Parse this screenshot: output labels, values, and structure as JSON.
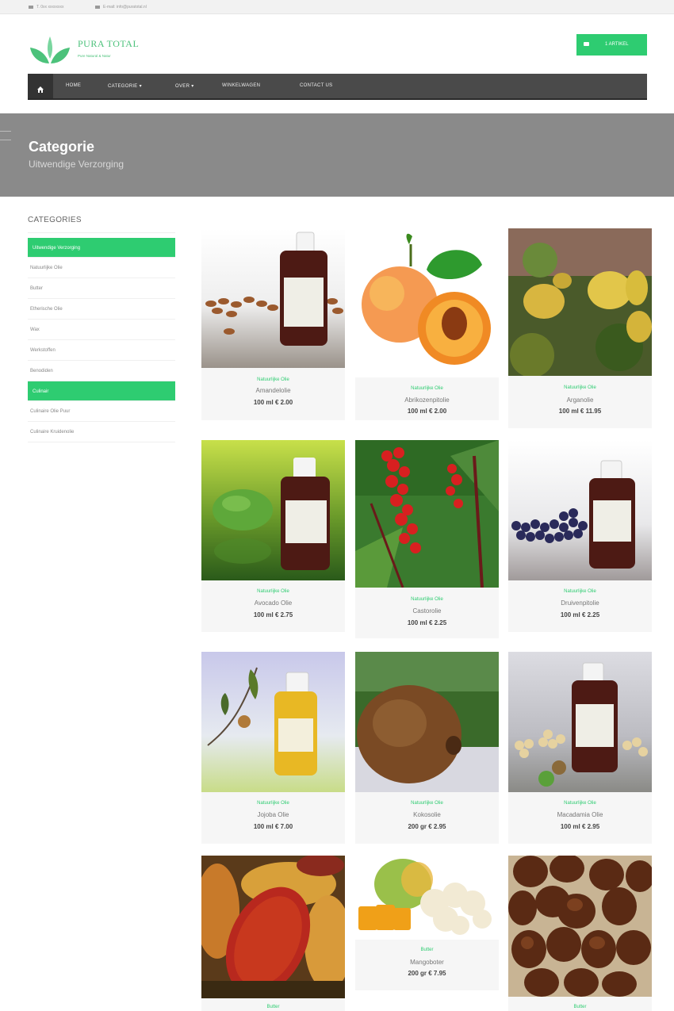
{
  "topbar": {
    "phone": "T. 0xx xxxxxxxx",
    "email": "E-mail: info@puratotal.nl"
  },
  "header": {
    "brand": "PURA TOTAL",
    "tagline": "Pure Natural & Natur"
  },
  "cart": {
    "label": "1 ARTIKEL"
  },
  "nav": {
    "items": [
      "HOME",
      "CATEGORIE",
      "OVER",
      "WINKELWAGEN",
      "CONTACT US"
    ]
  },
  "page": {
    "title": "Categorie",
    "subtitle": "Uitwendige Verzorging"
  },
  "sidebar": {
    "heading": "CATEGORIES",
    "items": [
      {
        "label": "Uitwendige Verzorging",
        "active": true
      },
      {
        "label": "Natuurlijke Olie",
        "active": false
      },
      {
        "label": "Butter",
        "active": false
      },
      {
        "label": "Etherische Olie",
        "active": false
      },
      {
        "label": "Wax",
        "active": false
      },
      {
        "label": "Werkstoffen",
        "active": false
      },
      {
        "label": "Benodiden",
        "active": false
      },
      {
        "label": "Culinair",
        "active": true
      },
      {
        "label": "Culinaire Olie Puur",
        "active": false
      },
      {
        "label": "Culinaire Kruidenolie",
        "active": false
      }
    ]
  },
  "products": [
    {
      "category": "Natuurlijke Olie",
      "name": "Amandelolie",
      "price": "100 ml € 2.00",
      "image": "almond-oil-bottle"
    },
    {
      "category": "Natuurlijke Olie",
      "name": "Abrikozenpitolie",
      "price": "100 ml € 2.00",
      "image": "apricot"
    },
    {
      "category": "Natuurlijke Olie",
      "name": "Arganolie",
      "price": "100 ml € 11.95",
      "image": "argan-fruit"
    },
    {
      "category": "Natuurlijke Olie",
      "name": "Avocado Olie",
      "price": "100 ml € 2.75",
      "image": "avocado-oil-bottle"
    },
    {
      "category": "Natuurlijke Olie",
      "name": "Castorolie",
      "price": "100 ml € 2.25",
      "image": "castor-plant"
    },
    {
      "category": "Natuurlijke Olie",
      "name": "Druivenpitolie",
      "price": "100 ml € 2.25",
      "image": "grapeseed-oil-bottle"
    },
    {
      "category": "Natuurlijke Olie",
      "name": "Jojoba Olie",
      "price": "100 ml € 7.00",
      "image": "jojoba-oil-bottle"
    },
    {
      "category": "Natuurlijke Olie",
      "name": "Kokosolie",
      "price": "200 gr € 2.95",
      "image": "coconut"
    },
    {
      "category": "Natuurlijke Olie",
      "name": "Macadamia Olie",
      "price": "100 ml € 2.95",
      "image": "macadamia-oil-bottle"
    },
    {
      "category": "Butter",
      "name": "",
      "price": "",
      "image": "cacao-pods"
    },
    {
      "category": "Butter",
      "name": "Mangoboter",
      "price": "200 gr € 7.95",
      "image": "mango-butter"
    },
    {
      "category": "Butter",
      "name": "",
      "price": "",
      "image": "shea-nuts"
    }
  ]
}
